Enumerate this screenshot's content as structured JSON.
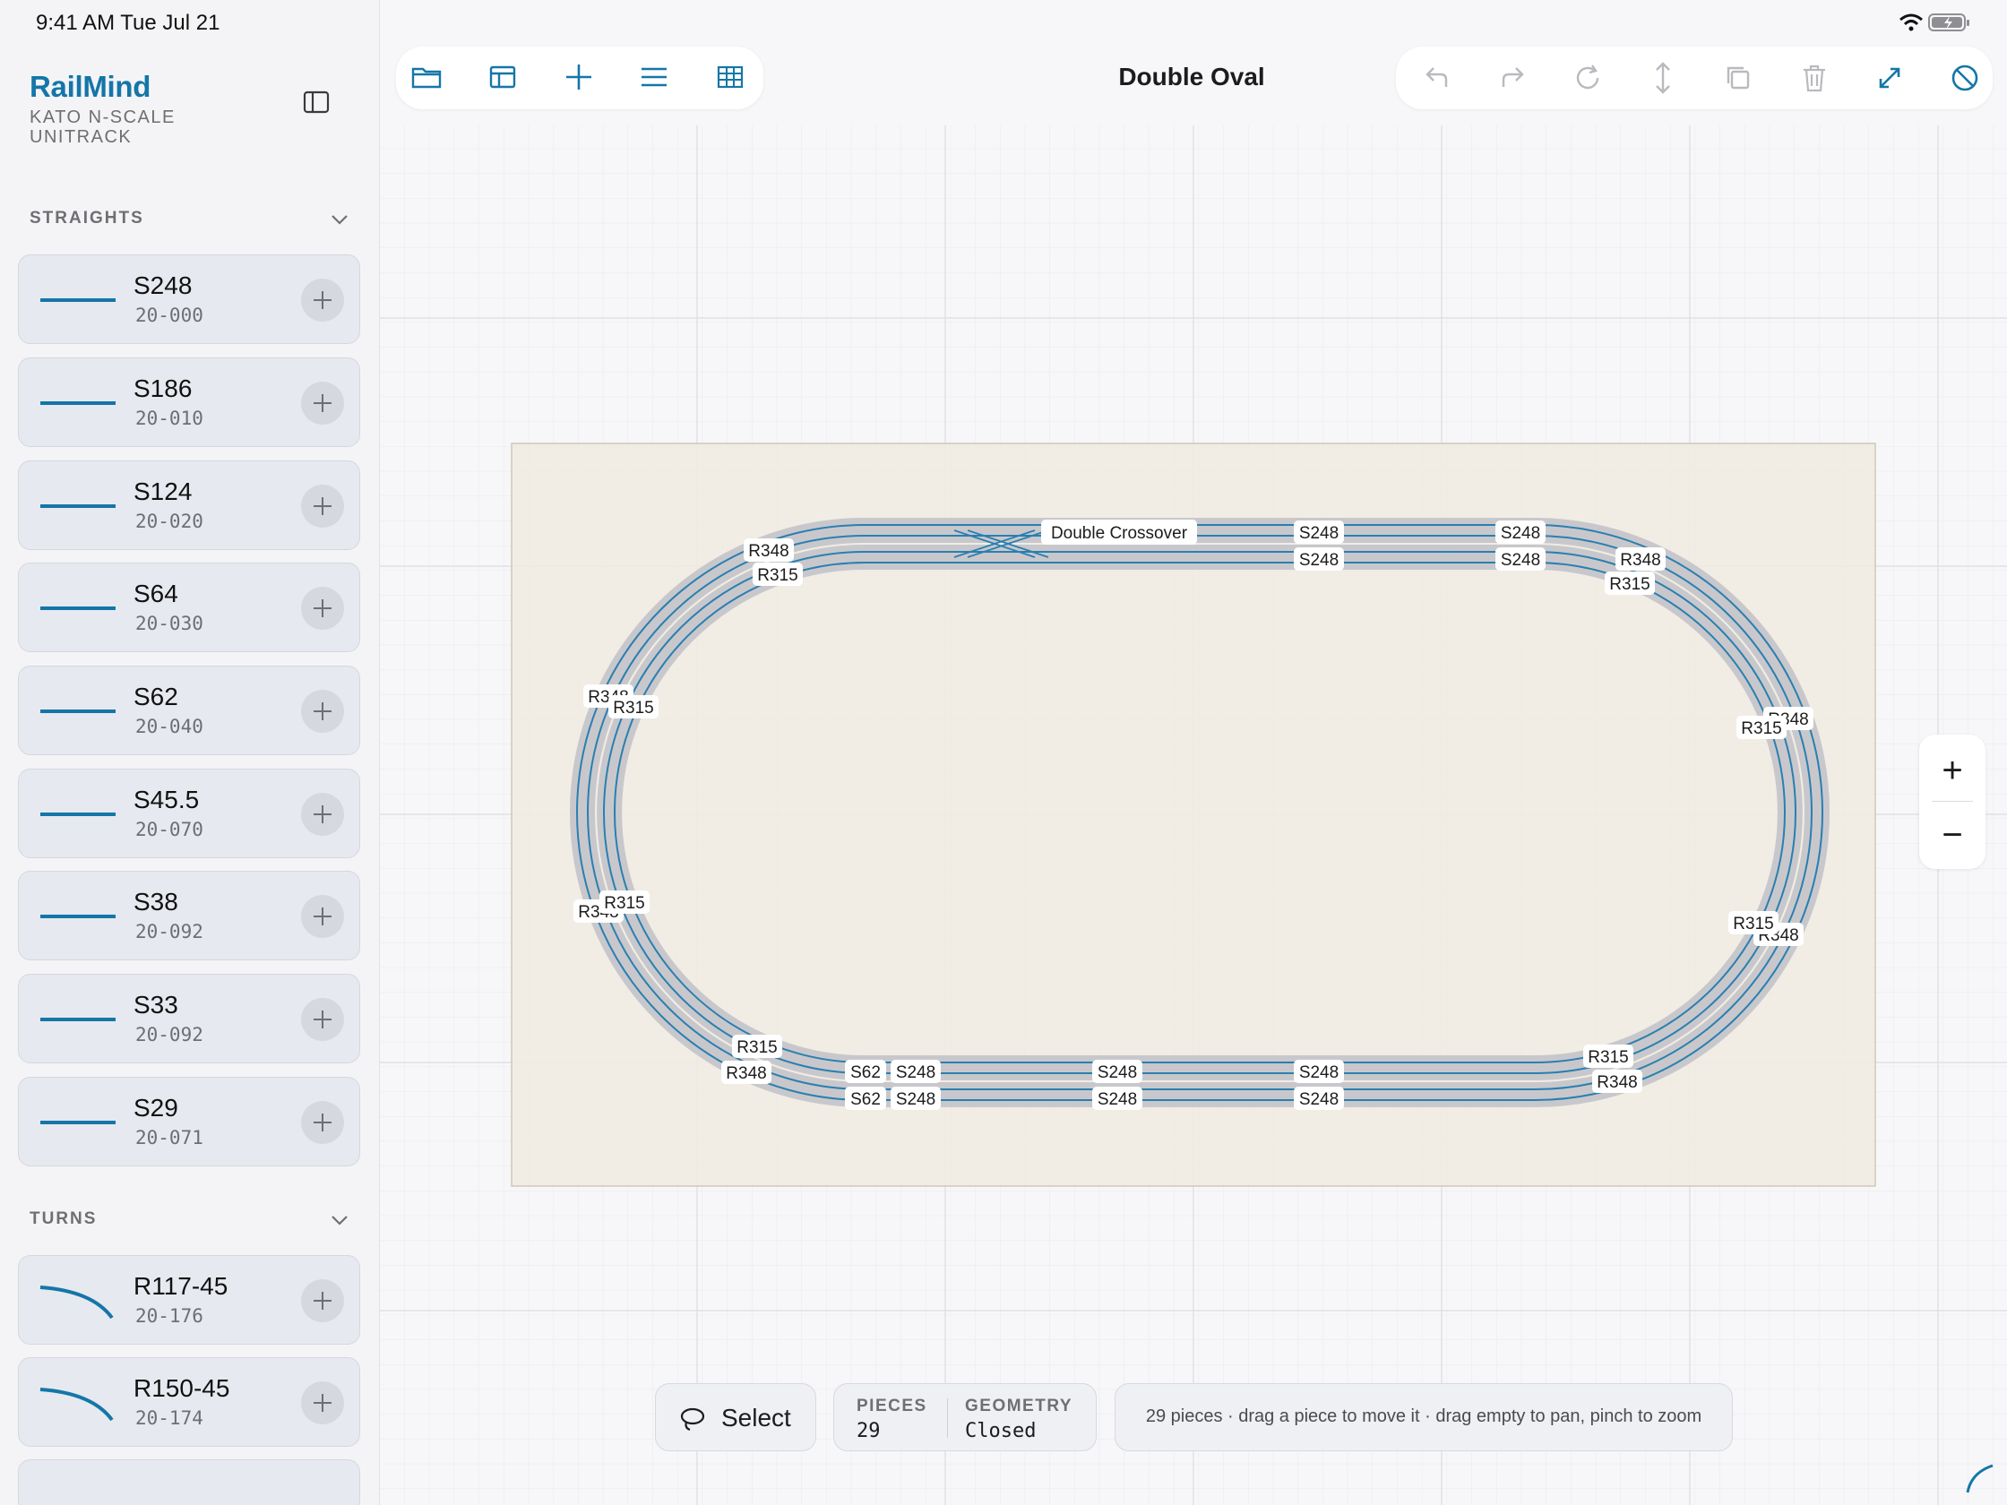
{
  "status": {
    "time": "9:41 AM   Tue Jul 21"
  },
  "sidebar": {
    "brand": "RailMind",
    "subtitle": "KATO N-SCALE UNITRACK",
    "sections": [
      {
        "title": "STRAIGHTS",
        "items": [
          {
            "name": "S248",
            "code": "20-000"
          },
          {
            "name": "S186",
            "code": "20-010"
          },
          {
            "name": "S124",
            "code": "20-020"
          },
          {
            "name": "S64",
            "code": "20-030"
          },
          {
            "name": "S62",
            "code": "20-040"
          },
          {
            "name": "S45.5",
            "code": "20-070"
          },
          {
            "name": "S38",
            "code": "20-092"
          },
          {
            "name": "S33",
            "code": "20-092"
          },
          {
            "name": "S29",
            "code": "20-071"
          }
        ]
      },
      {
        "title": "TURNS",
        "items": [
          {
            "name": "R117-45",
            "code": "20-176"
          },
          {
            "name": "R150-45",
            "code": "20-174"
          }
        ]
      }
    ]
  },
  "toolbar": {
    "left_icons": [
      "folder-icon",
      "layout-icon",
      "add-icon",
      "list-icon",
      "grid-icon"
    ],
    "right_icons": [
      "undo-icon",
      "redo-icon",
      "rotate-icon",
      "flip-icon",
      "duplicate-icon",
      "trash-icon",
      "expand-icon",
      "disable-icon"
    ]
  },
  "document": {
    "title": "Double Oval"
  },
  "layout": {
    "labels": {
      "crossover": "Double Crossover",
      "s248": "S248",
      "s62": "S62",
      "r348": "R348",
      "r315": "R315"
    }
  },
  "zoom": {
    "in": "+",
    "out": "−"
  },
  "bottom": {
    "select_label": "Select",
    "pieces_label": "PIECES",
    "pieces_value": "29",
    "geometry_label": "GEOMETRY",
    "geometry_value": "Closed",
    "hint": "29 pieces  ·  drag a piece to move it  ·  drag empty to pan, pinch to zoom"
  },
  "colors": {
    "accent": "#1476a8",
    "board": "#efebe2",
    "rail": "#2a7fb0"
  }
}
